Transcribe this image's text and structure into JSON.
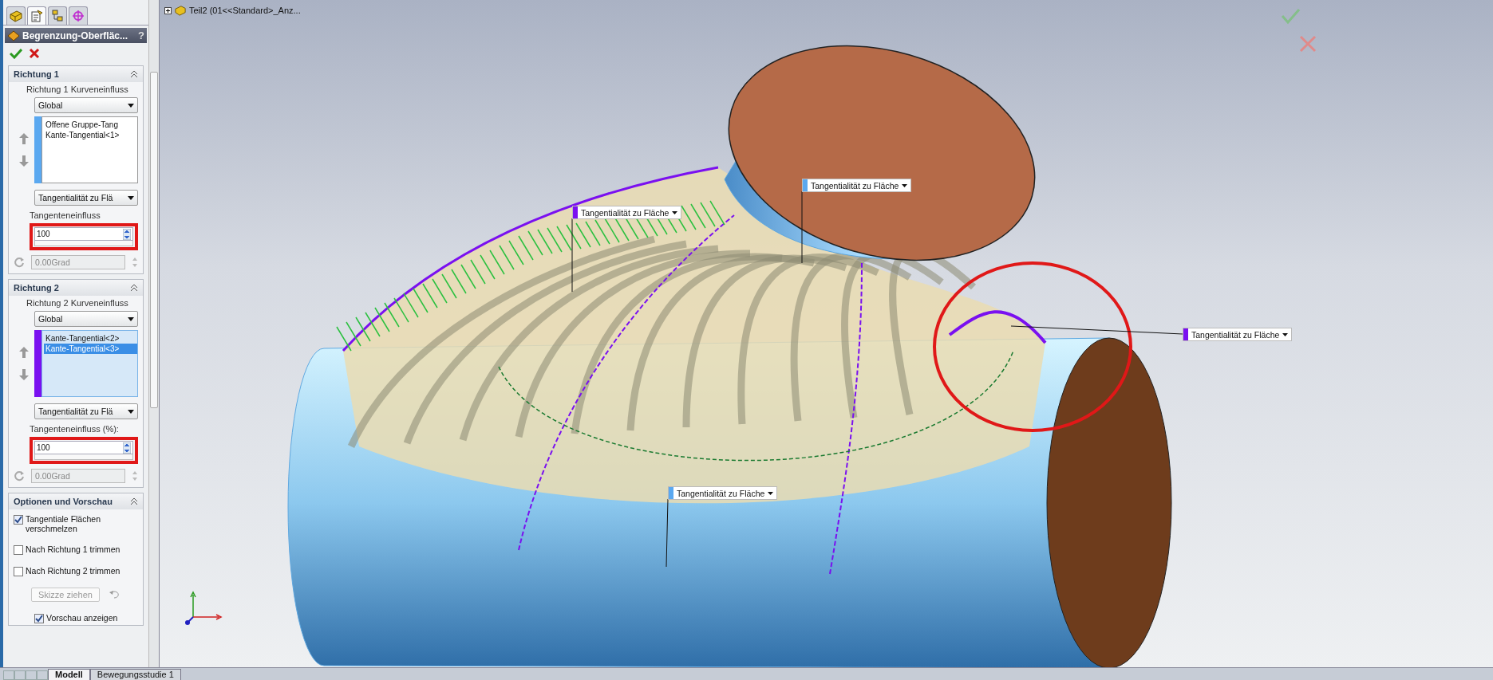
{
  "panel": {
    "tabs": [
      {
        "kind": "part",
        "selected": false
      },
      {
        "kind": "property",
        "selected": true
      },
      {
        "kind": "config",
        "selected": false
      },
      {
        "kind": "target",
        "selected": false
      }
    ],
    "title": "Begrenzung-Oberfläc...",
    "help": "?",
    "sections": [
      {
        "title": "Richtung 1",
        "influence_label": "Richtung 1 Kurveneinfluss",
        "influence": "Global",
        "color": "#5aa8f0",
        "items": [
          {
            "label": "Offene Gruppe-Tang",
            "selected": false
          },
          {
            "label": "Kante-Tangential<1>",
            "selected": false
          }
        ],
        "tangency": "Tangentialität zu Flä",
        "tangent_label": "Tangenteneinfluss",
        "tangent_value": "100",
        "angle": "0.00Grad"
      },
      {
        "title": "Richtung  2",
        "influence_label": "Richtung 2 Kurveneinfluss",
        "influence": "Global",
        "color": "#7a10f0",
        "items": [
          {
            "label": "Kante-Tangential<2>",
            "selected": false
          },
          {
            "label": "Kante-Tangential<3>",
            "selected": true
          }
        ],
        "tangency": "Tangentialität zu Flä",
        "tangent_label": "Tangenteneinfluss  (%):",
        "tangent_value": "100",
        "angle": "0.00Grad"
      }
    ],
    "options": {
      "title": "Optionen und Vorschau",
      "items": [
        {
          "kind": "checkbox",
          "label": "Tangentiale Flächen verschmelzen",
          "checked": true
        },
        {
          "kind": "checkbox",
          "label": "Nach Richtung 1 trimmen",
          "checked": false
        },
        {
          "kind": "checkbox",
          "label": "Nach Richtung 2 trimmen",
          "checked": false
        },
        {
          "kind": "button",
          "label": "Skizze ziehen",
          "disabled": true
        },
        {
          "kind": "checkbox",
          "label": "Vorschau anzeigen",
          "checked": true
        }
      ]
    }
  },
  "viewport": {
    "tree_label": "Teil2  (01<<Standard>_Anz...",
    "callouts": [
      {
        "label": "Tangentialität zu Fläche",
        "color": "#5aa8f0"
      },
      {
        "label": "Tangentialität zu Fläche",
        "color": "#7a10f0"
      },
      {
        "label": "Tangentialität zu Fläche",
        "color": "#7a10f0"
      },
      {
        "label": "Tangentialität zu Fläche",
        "color": "#5aa8f0"
      }
    ]
  },
  "bottom_tabs": [
    {
      "label": "Modell",
      "selected": true
    },
    {
      "label": "Bewegungsstudie 1",
      "selected": false
    }
  ]
}
